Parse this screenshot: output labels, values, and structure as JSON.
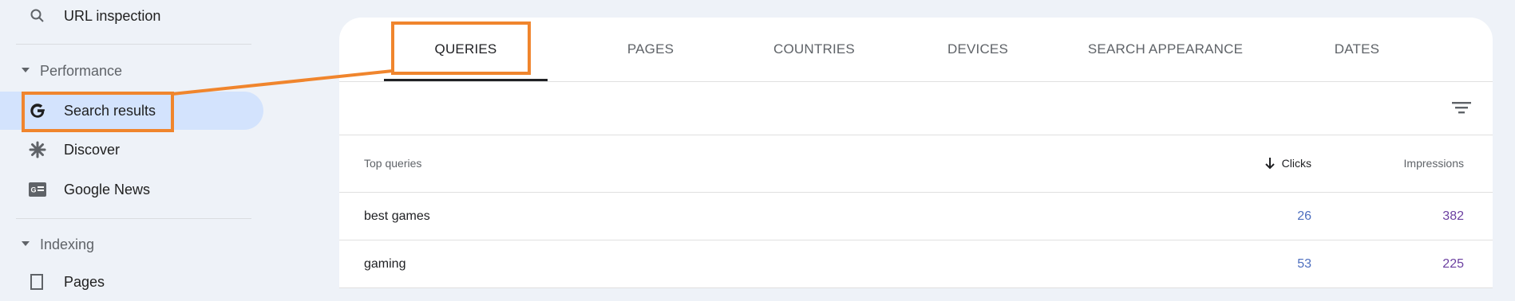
{
  "sidebar": {
    "url_inspection": "URL inspection",
    "performance_section": "Performance",
    "search_results": "Search results",
    "discover": "Discover",
    "google_news": "Google News",
    "indexing_section": "Indexing",
    "pages_partial": "Pages"
  },
  "tabs": [
    "QUERIES",
    "PAGES",
    "COUNTRIES",
    "DEVICES",
    "SEARCH APPEARANCE",
    "DATES"
  ],
  "table": {
    "header_query": "Top queries",
    "header_clicks": "Clicks",
    "header_impressions": "Impressions",
    "rows": [
      {
        "query": "best games",
        "clicks": "26",
        "impressions": "382"
      },
      {
        "query": "gaming",
        "clicks": "53",
        "impressions": "225"
      }
    ]
  },
  "colors": {
    "accent_active": "#d3e3fd",
    "annotation": "#f0852d",
    "clicks": "#4e6fbf",
    "impressions": "#6b3fa0"
  }
}
